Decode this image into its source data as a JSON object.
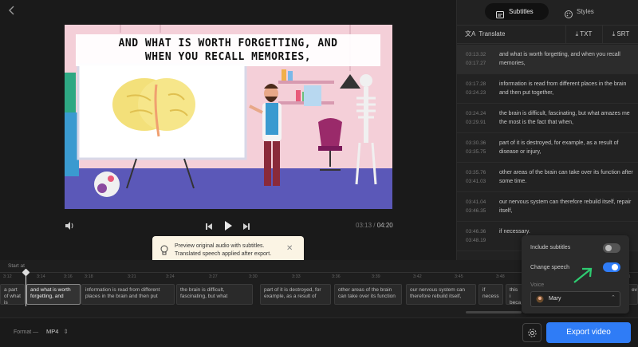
{
  "player": {
    "subtitle_line1": "AND WHAT IS WORTH FORGETTING, AND",
    "subtitle_line2": "WHEN YOU RECALL MEMORIES,",
    "current_time": "03:13",
    "separator": "/",
    "total_time": "04:20"
  },
  "tooltip": {
    "line1": "Preview original audio with subtitles.",
    "line2": "Translated speech applied after export."
  },
  "tabs": {
    "subtitles": "Subtitles",
    "styles": "Styles"
  },
  "toolbar": {
    "translate": "Translate",
    "txt": "TXT",
    "srt": "SRT"
  },
  "subtitles": [
    {
      "start": "03:13.32",
      "end": "03:17.27",
      "text": "and what is worth forgetting, and when you recall memories,"
    },
    {
      "start": "03:17.28",
      "end": "03:24.23",
      "text": "information is read from different places in the brain and then put together,"
    },
    {
      "start": "03:24.24",
      "end": "03:29.91",
      "text": "the brain is difficult, fascinating, but what amazes me the most is the fact that when,"
    },
    {
      "start": "03:30.36",
      "end": "03:35.75",
      "text": "part of it is destroyed, for example, as a result of disease or injury,"
    },
    {
      "start": "03:35.76",
      "end": "03:41.03",
      "text": "other areas of the brain can take over its function after some time."
    },
    {
      "start": "03:41.04",
      "end": "03:46.35",
      "text": "our nervous system can therefore rebuild itself, repair itself,"
    },
    {
      "start": "03:46.36",
      "end": "03:48.19",
      "text": "if necessary."
    }
  ],
  "popup": {
    "include_subtitles": "Include subtitles",
    "include_subtitles_on": false,
    "change_speech": "Change speech",
    "change_speech_on": true,
    "voice_label": "Voice",
    "voice_value": "Mary"
  },
  "timeline": {
    "start_at": "Start at",
    "ticks": [
      "3:12",
      "3:14",
      "3:16",
      "3:18",
      "3:21",
      "3:24",
      "3:27",
      "3:30",
      "3:33",
      "3:36",
      "3:39",
      "3:42",
      "3:45",
      "3:48",
      "3:51"
    ],
    "clips": [
      "a part of what is",
      "and what is worth forgetting, and",
      "information is read from different places in the brain and then put",
      "the brain is difficult, fascinating, but what",
      "part of it is destroyed, for example, as a result of",
      "other areas of the brain can take over its function",
      "our nervous system can therefore rebuild itself,",
      "if necess",
      "this i beca",
      "ev"
    ]
  },
  "bottom": {
    "format_label": "Format —",
    "format_value": "MP4",
    "export": "Export video"
  },
  "colors": {
    "accent": "#2f7cf6",
    "toggle_on": "#2f7cf6",
    "arrow": "#2ecc71"
  }
}
